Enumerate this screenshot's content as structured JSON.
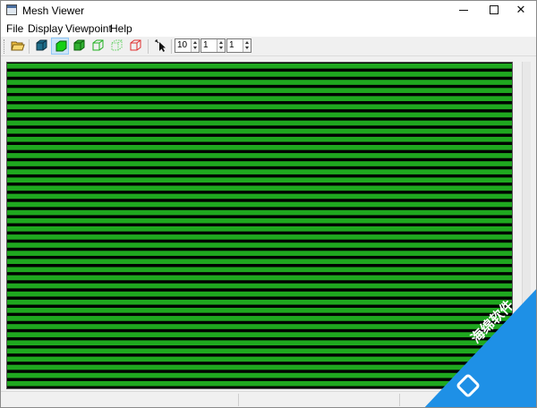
{
  "window": {
    "title": "Mesh Viewer"
  },
  "menu": [
    "File",
    "Display",
    "Viewpoint",
    "Help"
  ],
  "toolbar": {
    "buttons": [
      {
        "name": "open-icon",
        "color": "#c08a10"
      },
      {
        "name": "shaded-cube-icon",
        "color": "#2d7a7a"
      },
      {
        "name": "solid-cube-icon",
        "color": "#16d016",
        "active": true
      },
      {
        "name": "flat-cube-icon",
        "color": "#30b030"
      },
      {
        "name": "wireframe-cube-icon",
        "color": "#20c020"
      },
      {
        "name": "dotted-cube-icon",
        "color": "#60d060"
      },
      {
        "name": "red-wire-cube-icon",
        "color": "#e03030"
      },
      {
        "name": "pointer-icon",
        "color": "#000000"
      }
    ],
    "spinners": [
      {
        "name": "subdivision-spinner",
        "value": "10"
      },
      {
        "name": "param-two-spinner",
        "value": "1"
      },
      {
        "name": "param-three-spinner",
        "value": "1"
      }
    ]
  },
  "viewport": {
    "stripe_color": "#1fa81f",
    "background_color": "#000000",
    "stripe_count": 40
  },
  "watermark": {
    "text": "海绵软件",
    "color": "#1e90e6"
  }
}
